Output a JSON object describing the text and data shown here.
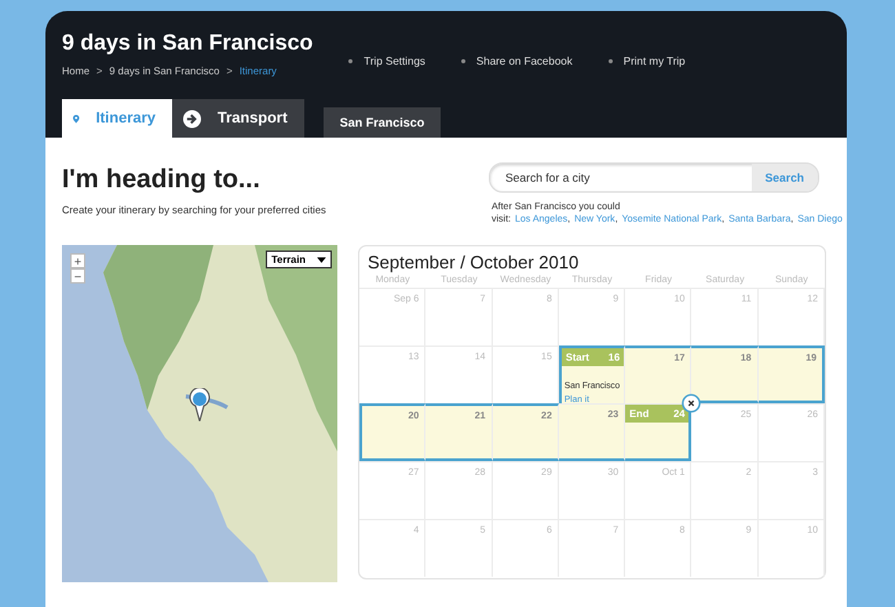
{
  "header": {
    "title": "9 days in San Francisco",
    "breadcrumb": {
      "separator": ">",
      "items": [
        {
          "label": "Home",
          "selected": false
        },
        {
          "label": "9 days in San Francisco",
          "selected": false
        },
        {
          "label": "Itinerary",
          "selected": true
        }
      ]
    },
    "links": [
      "Trip Settings",
      "Share on Facebook",
      "Print my Trip"
    ],
    "tabs": [
      {
        "label": "Itinerary",
        "selected": true
      },
      {
        "label": "Transport",
        "selected": false
      }
    ],
    "city_tabs": [
      {
        "label": "San Francisco",
        "selected": false
      }
    ]
  },
  "intro": {
    "heading": "I'm heading to...",
    "subtitle": "Create your itinerary by searching for your preferred cities"
  },
  "search": {
    "placeholder": "Search for a city",
    "button": "Search",
    "suggestion_label": "After San Francisco you could visit:",
    "suggestion_separator": ",",
    "suggestions": [
      "Los Angeles",
      "New York",
      "Yosemite National Park",
      "Santa Barbara",
      "San Diego"
    ]
  },
  "map": {
    "zoom_in": "+",
    "zoom_out": "−",
    "map_type": "Terrain"
  },
  "calendar": {
    "title": "September / October 2010",
    "weekdays": [
      "Monday",
      "Tuesday",
      "Wednesday",
      "Thursday",
      "Friday",
      "Saturday",
      "Sunday"
    ],
    "days": [
      {
        "day": "Sep 6",
        "in_trip": false
      },
      {
        "day": "7",
        "in_trip": false
      },
      {
        "day": "8",
        "in_trip": false
      },
      {
        "day": "9",
        "in_trip": false
      },
      {
        "day": "10",
        "in_trip": false
      },
      {
        "day": "11",
        "in_trip": false
      },
      {
        "day": "12",
        "in_trip": false
      },
      {
        "day": "13",
        "in_trip": false
      },
      {
        "day": "14",
        "in_trip": false
      },
      {
        "day": "15",
        "in_trip": false
      },
      {
        "day": "16",
        "in_trip": true,
        "marker": "Start",
        "event": {
          "title": "San Francisco",
          "link": "Plan it"
        }
      },
      {
        "day": "17",
        "in_trip": true
      },
      {
        "day": "18",
        "in_trip": true
      },
      {
        "day": "19",
        "in_trip": true
      },
      {
        "day": "20",
        "in_trip": true
      },
      {
        "day": "21",
        "in_trip": true
      },
      {
        "day": "22",
        "in_trip": true
      },
      {
        "day": "23",
        "in_trip": true
      },
      {
        "day": "24",
        "in_trip": true,
        "marker": "End",
        "removable": true
      },
      {
        "day": "25",
        "in_trip": false
      },
      {
        "day": "26",
        "in_trip": false
      },
      {
        "day": "27",
        "in_trip": false
      },
      {
        "day": "28",
        "in_trip": false
      },
      {
        "day": "29",
        "in_trip": false
      },
      {
        "day": "30",
        "in_trip": false
      },
      {
        "day": "Oct 1",
        "in_trip": false
      },
      {
        "day": "2",
        "in_trip": false
      },
      {
        "day": "3",
        "in_trip": false
      },
      {
        "day": "4",
        "in_trip": false
      },
      {
        "day": "5",
        "in_trip": false
      },
      {
        "day": "6",
        "in_trip": false
      },
      {
        "day": "7",
        "in_trip": false
      },
      {
        "day": "8",
        "in_trip": false
      },
      {
        "day": "9",
        "in_trip": false
      },
      {
        "day": "10",
        "in_trip": false
      }
    ]
  }
}
